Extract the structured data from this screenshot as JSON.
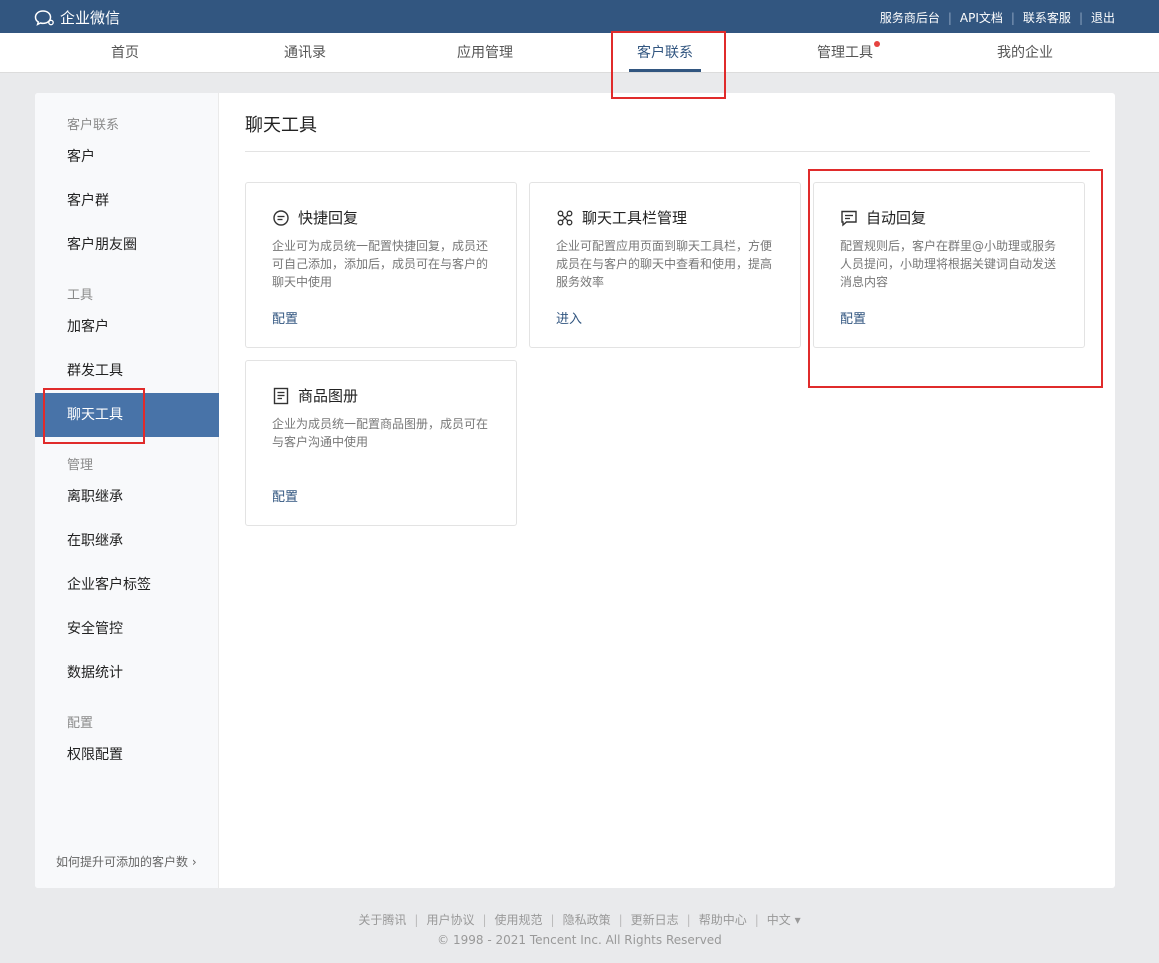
{
  "topbar": {
    "brand": "企业微信",
    "links": [
      "服务商后台",
      "API文档",
      "联系客服",
      "退出"
    ]
  },
  "nav": {
    "items": [
      "首页",
      "通讯录",
      "应用管理",
      "客户联系",
      "管理工具",
      "我的企业"
    ],
    "active_index": 3
  },
  "sidebar": {
    "groups": {
      "customer": "客户联系",
      "tools": "工具",
      "manage": "管理",
      "config": "配置"
    },
    "items": {
      "customer": "客户",
      "customer_group": "客户群",
      "moments": "客户朋友圈",
      "add_customer": "加客户",
      "mass_send": "群发工具",
      "chat_tools": "聊天工具",
      "resign_inherit": "离职继承",
      "onjob_inherit": "在职继承",
      "tags": "企业客户标签",
      "security": "安全管控",
      "stats": "数据统计",
      "permissions": "权限配置"
    },
    "footer": "如何提升可添加的客户数 ›"
  },
  "content": {
    "title": "聊天工具",
    "cards": [
      {
        "title": "快捷回复",
        "icon": "quick-reply-icon",
        "desc": "企业可为成员统一配置快捷回复，成员还可自己添加，添加后，成员可在与客户的聊天中使用",
        "link": "配置"
      },
      {
        "title": "聊天工具栏管理",
        "icon": "toolbar-icon",
        "desc": "企业可配置应用页面到聊天工具栏，方便成员在与客户的聊天中查看和使用，提高服务效率",
        "link": "进入"
      },
      {
        "title": "自动回复",
        "icon": "auto-reply-icon",
        "desc": "配置规则后，客户在群里@小助理或服务人员提问，小助理将根据关键词自动发送消息内容",
        "link": "配置"
      },
      {
        "title": "商品图册",
        "icon": "catalog-icon",
        "desc": "企业为成员统一配置商品图册，成员可在与客户沟通中使用",
        "link": "配置"
      }
    ]
  },
  "footer": {
    "links": [
      "关于腾讯",
      "用户协议",
      "使用规范",
      "隐私政策",
      "更新日志",
      "帮助中心",
      "中文 ▾"
    ],
    "copyright": "© 1998 - 2021 Tencent Inc. All Rights Reserved"
  },
  "colors": {
    "topbar": "#325680",
    "active_sidebar": "#4873a8",
    "annotation": "#e02b2b",
    "notification_dot": "#e64340"
  }
}
